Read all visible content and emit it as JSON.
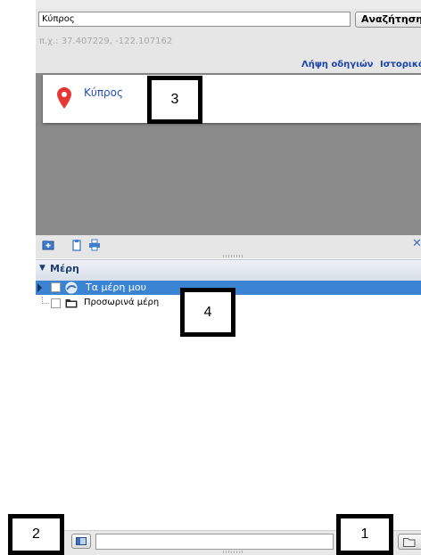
{
  "search": {
    "query": "Κύπρος",
    "button_label": "Αναζήτηση",
    "coord_hint": "π.χ.: 37.407229, -122.107162",
    "get_directions": "Λήψη οδηγιών",
    "history": "Ιστορικό"
  },
  "results": [
    {
      "title": "Κύπρος"
    }
  ],
  "places": {
    "header": "Μέρη",
    "items": [
      {
        "label": "Τα μέρη μου"
      },
      {
        "label": "Προσωρινά μέρη"
      }
    ]
  },
  "callouts": {
    "c1": "1",
    "c2": "2",
    "c3": "3",
    "c4": "4"
  },
  "colors": {
    "selected_row": "#3b84d4",
    "link": "#1a44a8",
    "pin": "#e53935"
  }
}
